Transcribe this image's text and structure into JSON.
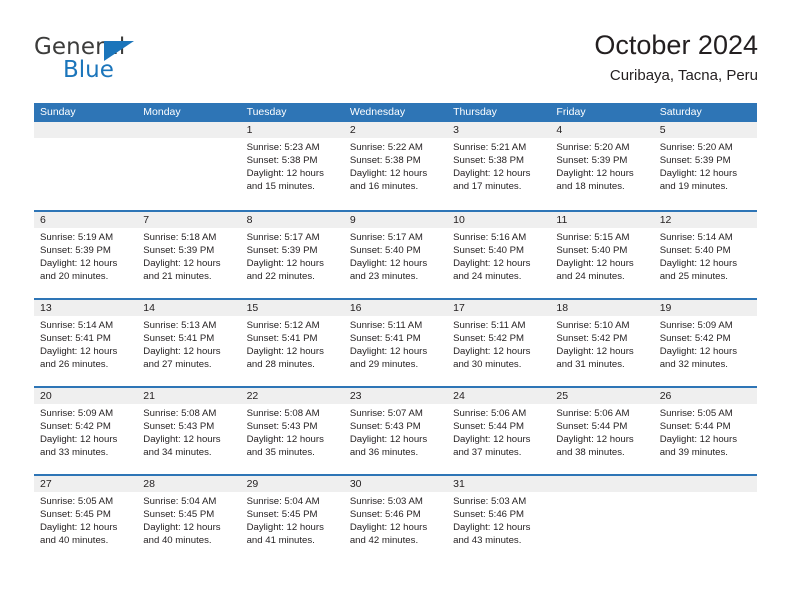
{
  "brand": {
    "name_part1": "General",
    "name_part2": "Blue",
    "triangle_icon": "triangle-icon",
    "accent_color": "#1b75bb"
  },
  "header": {
    "title": "October 2024",
    "subtitle": "Curibaya, Tacna, Peru"
  },
  "theme": {
    "header_blue": "#2e75b6",
    "band_gray": "#efefef",
    "text_color": "#231f20"
  },
  "weekdays": [
    "Sunday",
    "Monday",
    "Tuesday",
    "Wednesday",
    "Thursday",
    "Friday",
    "Saturday"
  ],
  "weeks": [
    [
      {
        "day": "",
        "lines": []
      },
      {
        "day": "",
        "lines": []
      },
      {
        "day": "1",
        "lines": [
          "Sunrise: 5:23 AM",
          "Sunset: 5:38 PM",
          "Daylight: 12 hours",
          "and 15 minutes."
        ]
      },
      {
        "day": "2",
        "lines": [
          "Sunrise: 5:22 AM",
          "Sunset: 5:38 PM",
          "Daylight: 12 hours",
          "and 16 minutes."
        ]
      },
      {
        "day": "3",
        "lines": [
          "Sunrise: 5:21 AM",
          "Sunset: 5:38 PM",
          "Daylight: 12 hours",
          "and 17 minutes."
        ]
      },
      {
        "day": "4",
        "lines": [
          "Sunrise: 5:20 AM",
          "Sunset: 5:39 PM",
          "Daylight: 12 hours",
          "and 18 minutes."
        ]
      },
      {
        "day": "5",
        "lines": [
          "Sunrise: 5:20 AM",
          "Sunset: 5:39 PM",
          "Daylight: 12 hours",
          "and 19 minutes."
        ]
      }
    ],
    [
      {
        "day": "6",
        "lines": [
          "Sunrise: 5:19 AM",
          "Sunset: 5:39 PM",
          "Daylight: 12 hours",
          "and 20 minutes."
        ]
      },
      {
        "day": "7",
        "lines": [
          "Sunrise: 5:18 AM",
          "Sunset: 5:39 PM",
          "Daylight: 12 hours",
          "and 21 minutes."
        ]
      },
      {
        "day": "8",
        "lines": [
          "Sunrise: 5:17 AM",
          "Sunset: 5:39 PM",
          "Daylight: 12 hours",
          "and 22 minutes."
        ]
      },
      {
        "day": "9",
        "lines": [
          "Sunrise: 5:17 AM",
          "Sunset: 5:40 PM",
          "Daylight: 12 hours",
          "and 23 minutes."
        ]
      },
      {
        "day": "10",
        "lines": [
          "Sunrise: 5:16 AM",
          "Sunset: 5:40 PM",
          "Daylight: 12 hours",
          "and 24 minutes."
        ]
      },
      {
        "day": "11",
        "lines": [
          "Sunrise: 5:15 AM",
          "Sunset: 5:40 PM",
          "Daylight: 12 hours",
          "and 24 minutes."
        ]
      },
      {
        "day": "12",
        "lines": [
          "Sunrise: 5:14 AM",
          "Sunset: 5:40 PM",
          "Daylight: 12 hours",
          "and 25 minutes."
        ]
      }
    ],
    [
      {
        "day": "13",
        "lines": [
          "Sunrise: 5:14 AM",
          "Sunset: 5:41 PM",
          "Daylight: 12 hours",
          "and 26 minutes."
        ]
      },
      {
        "day": "14",
        "lines": [
          "Sunrise: 5:13 AM",
          "Sunset: 5:41 PM",
          "Daylight: 12 hours",
          "and 27 minutes."
        ]
      },
      {
        "day": "15",
        "lines": [
          "Sunrise: 5:12 AM",
          "Sunset: 5:41 PM",
          "Daylight: 12 hours",
          "and 28 minutes."
        ]
      },
      {
        "day": "16",
        "lines": [
          "Sunrise: 5:11 AM",
          "Sunset: 5:41 PM",
          "Daylight: 12 hours",
          "and 29 minutes."
        ]
      },
      {
        "day": "17",
        "lines": [
          "Sunrise: 5:11 AM",
          "Sunset: 5:42 PM",
          "Daylight: 12 hours",
          "and 30 minutes."
        ]
      },
      {
        "day": "18",
        "lines": [
          "Sunrise: 5:10 AM",
          "Sunset: 5:42 PM",
          "Daylight: 12 hours",
          "and 31 minutes."
        ]
      },
      {
        "day": "19",
        "lines": [
          "Sunrise: 5:09 AM",
          "Sunset: 5:42 PM",
          "Daylight: 12 hours",
          "and 32 minutes."
        ]
      }
    ],
    [
      {
        "day": "20",
        "lines": [
          "Sunrise: 5:09 AM",
          "Sunset: 5:42 PM",
          "Daylight: 12 hours",
          "and 33 minutes."
        ]
      },
      {
        "day": "21",
        "lines": [
          "Sunrise: 5:08 AM",
          "Sunset: 5:43 PM",
          "Daylight: 12 hours",
          "and 34 minutes."
        ]
      },
      {
        "day": "22",
        "lines": [
          "Sunrise: 5:08 AM",
          "Sunset: 5:43 PM",
          "Daylight: 12 hours",
          "and 35 minutes."
        ]
      },
      {
        "day": "23",
        "lines": [
          "Sunrise: 5:07 AM",
          "Sunset: 5:43 PM",
          "Daylight: 12 hours",
          "and 36 minutes."
        ]
      },
      {
        "day": "24",
        "lines": [
          "Sunrise: 5:06 AM",
          "Sunset: 5:44 PM",
          "Daylight: 12 hours",
          "and 37 minutes."
        ]
      },
      {
        "day": "25",
        "lines": [
          "Sunrise: 5:06 AM",
          "Sunset: 5:44 PM",
          "Daylight: 12 hours",
          "and 38 minutes."
        ]
      },
      {
        "day": "26",
        "lines": [
          "Sunrise: 5:05 AM",
          "Sunset: 5:44 PM",
          "Daylight: 12 hours",
          "and 39 minutes."
        ]
      }
    ],
    [
      {
        "day": "27",
        "lines": [
          "Sunrise: 5:05 AM",
          "Sunset: 5:45 PM",
          "Daylight: 12 hours",
          "and 40 minutes."
        ]
      },
      {
        "day": "28",
        "lines": [
          "Sunrise: 5:04 AM",
          "Sunset: 5:45 PM",
          "Daylight: 12 hours",
          "and 40 minutes."
        ]
      },
      {
        "day": "29",
        "lines": [
          "Sunrise: 5:04 AM",
          "Sunset: 5:45 PM",
          "Daylight: 12 hours",
          "and 41 minutes."
        ]
      },
      {
        "day": "30",
        "lines": [
          "Sunrise: 5:03 AM",
          "Sunset: 5:46 PM",
          "Daylight: 12 hours",
          "and 42 minutes."
        ]
      },
      {
        "day": "31",
        "lines": [
          "Sunrise: 5:03 AM",
          "Sunset: 5:46 PM",
          "Daylight: 12 hours",
          "and 43 minutes."
        ]
      },
      {
        "day": "",
        "lines": []
      },
      {
        "day": "",
        "lines": []
      }
    ]
  ]
}
